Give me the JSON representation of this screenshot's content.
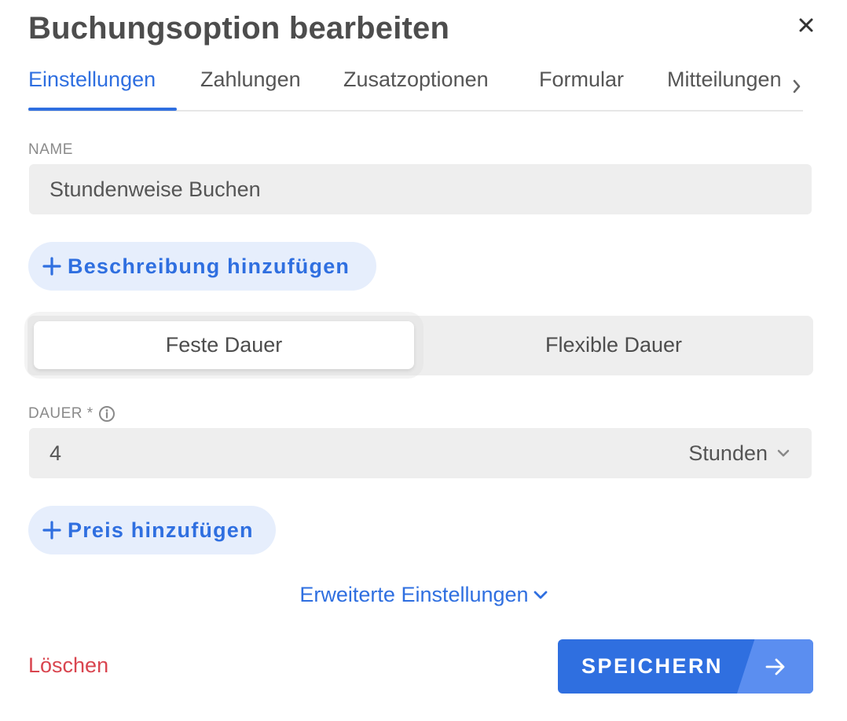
{
  "dialog": {
    "title": "Buchungsoption bearbeiten",
    "close_icon": "close-icon"
  },
  "tabs": [
    {
      "label": "Einstellungen",
      "active": true
    },
    {
      "label": "Zahlungen",
      "active": false
    },
    {
      "label": "Zusatzoptionen",
      "active": false
    },
    {
      "label": "Formular",
      "active": false
    },
    {
      "label": "Mitteilungen",
      "active": false
    }
  ],
  "name_field": {
    "label": "NAME",
    "value": "Stundenweise Buchen"
  },
  "add_description": {
    "label": "Beschreibung hinzufügen",
    "icon": "plus-icon"
  },
  "duration_mode": {
    "options": [
      "Feste Dauer",
      "Flexible Dauer"
    ],
    "selected": "Feste Dauer"
  },
  "duration_field": {
    "label": "DAUER *",
    "info_icon": "info-icon",
    "value": "4",
    "unit": "Stunden",
    "unit_icon": "chevron-down-icon"
  },
  "add_price": {
    "label": "Preis hinzufügen",
    "icon": "plus-icon"
  },
  "advanced": {
    "label": "Erweiterte Einstellungen",
    "icon": "chevron-down-icon"
  },
  "footer": {
    "delete_label": "Löschen",
    "save_label": "SPEICHERN",
    "save_icon": "arrow-right-icon"
  },
  "colors": {
    "accent": "#2f6fe0",
    "danger": "#d9454f",
    "field_bg": "#eeeeee",
    "pill_bg": "#e6eefc"
  }
}
